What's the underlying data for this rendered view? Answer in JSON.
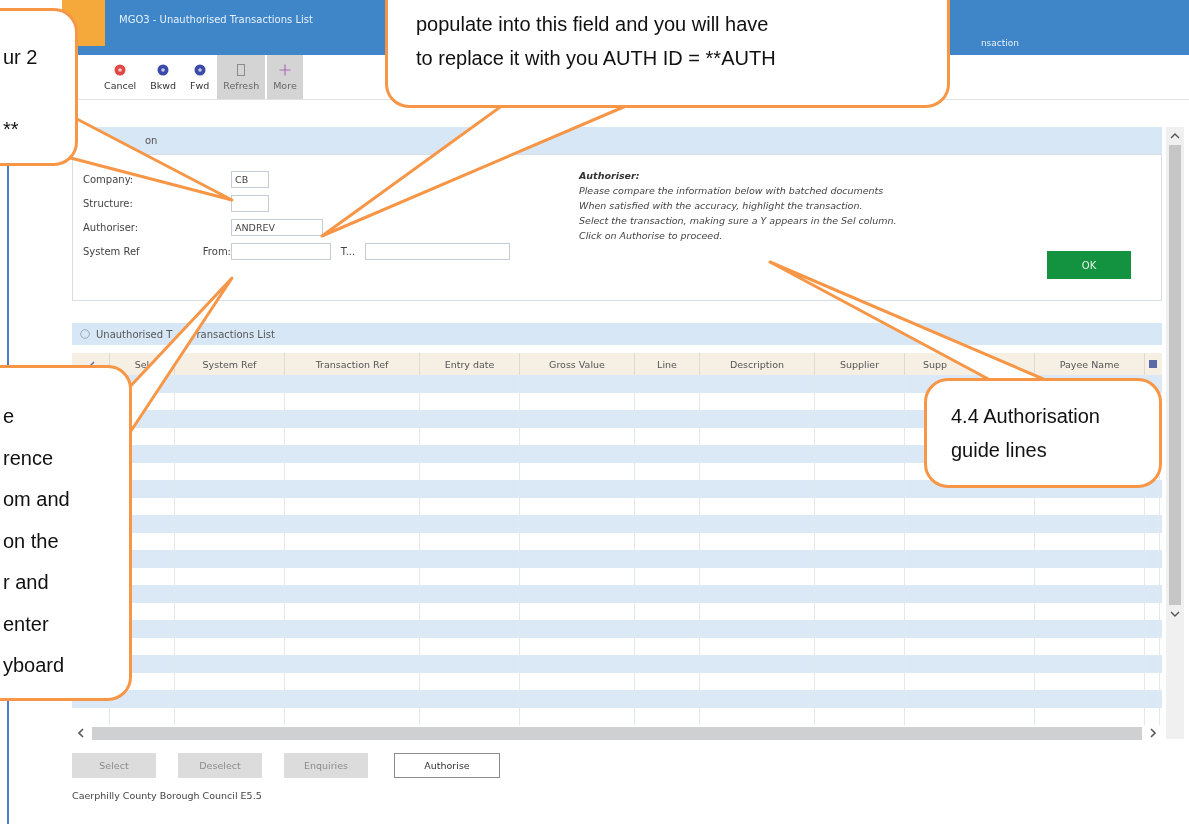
{
  "window": {
    "title": "MGO3 - Unauthorised Transactions List",
    "title_right": "nsaction"
  },
  "toolbar": [
    {
      "label": "Cancel",
      "disabled": false
    },
    {
      "label": "Bkwd",
      "disabled": false
    },
    {
      "label": "Fwd",
      "disabled": false
    },
    {
      "label": "Refresh",
      "disabled": true
    },
    {
      "label": "More",
      "disabled": true
    }
  ],
  "selection_panel": {
    "title": "on",
    "fields": [
      {
        "label": "Company:",
        "value": "CB"
      },
      {
        "label": "Structure:"
      },
      {
        "label": "Authoriser:",
        "value": "ANDREV"
      }
    ],
    "system_ref": {
      "label": "System Ref",
      "from_label": "From:",
      "to_label": "T..."
    },
    "guide_title": "Authoriser:",
    "guide_lines": [
      "Please compare the information below with batched documents",
      "When satisfied with the accuracy, highlight the transaction.",
      "Select the transaction, making sure a Y appears in the Sel column.",
      "Click on Authorise to proceed."
    ],
    "ok_button": "OK"
  },
  "table": {
    "title_parts": [
      "Unauthorised T",
      "ransactions List"
    ],
    "columns": [
      "Sel",
      "System Ref",
      "Transaction Ref",
      "Entry date",
      "Gross Value",
      "Line",
      "Description",
      "Supplier",
      "Supp",
      "Payee Name"
    ]
  },
  "buttons": [
    {
      "label": "Select",
      "disabled": true
    },
    {
      "label": "Deselect",
      "disabled": true
    },
    {
      "label": "Enquiries",
      "disabled": true
    },
    {
      "label": "Authorise",
      "disabled": false
    }
  ],
  "footer": "Caerphilly County Borough Council E5.5",
  "callouts": [
    {
      "lines": [
        "ur 2",
        "**"
      ]
    },
    {
      "lines": [
        "populate into this field and you will have",
        "to replace it with you AUTH ID = **AUTH"
      ]
    },
    {
      "lines": [
        "e",
        "rence",
        "om and",
        "on the",
        "r and",
        "enter",
        "yboard"
      ]
    },
    {
      "lines": [
        "4.4 Authorisation",
        "guide lines"
      ]
    }
  ]
}
